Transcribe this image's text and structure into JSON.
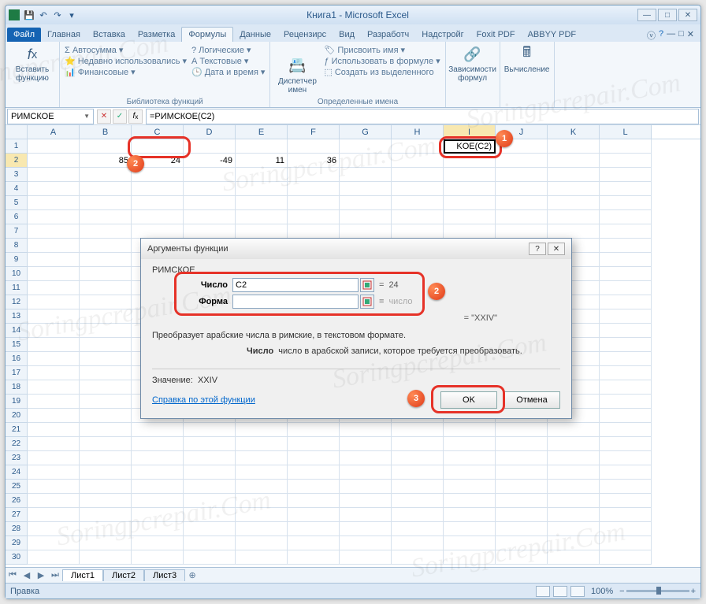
{
  "window": {
    "title": "Книга1 - Microsoft Excel"
  },
  "ribbon_tabs": {
    "file": "Файл",
    "items": [
      "Главная",
      "Вставка",
      "Разметка",
      "Формулы",
      "Данные",
      "Рецензирc",
      "Вид",
      "Разработч",
      "Надстройг",
      "Foxit PDF",
      "ABBYY PDF"
    ],
    "active_index": 3
  },
  "ribbon": {
    "insert_fn": "Вставить функцию",
    "lib": {
      "autosum": "Автосумма",
      "recent": "Недавно использовались",
      "financial": "Финансовые",
      "label": "Библиотека функций",
      "logical": "Логические",
      "text": "Текстовые",
      "datetime": "Дата и время"
    },
    "names": {
      "manager": "Диспетчер имен",
      "assign": "Присвоить имя",
      "use": "Использовать в формуле",
      "create": "Создать из выделенного",
      "label": "Определенные имена"
    },
    "deps": "Зависимости формул",
    "calc": "Вычисление"
  },
  "namebox": "РИМСКОЕ",
  "formula": "=РИМСКОЕ(C2)",
  "columns": [
    "A",
    "B",
    "C",
    "D",
    "E",
    "F",
    "G",
    "H",
    "I",
    "J",
    "K",
    "L"
  ],
  "cells": {
    "B2": "85",
    "C2": "24",
    "D2": "-49",
    "E2": "11",
    "F2": "36",
    "I2": "KOE(C2)"
  },
  "sheets": {
    "active": "Лист1",
    "others": [
      "Лист2",
      "Лист3"
    ]
  },
  "status": {
    "mode": "Правка",
    "zoom": "100%"
  },
  "dialog": {
    "title": "Аргументы функции",
    "fn": "РИМСКОЕ",
    "arg1_label": "Число",
    "arg1_value": "C2",
    "arg1_result": "24",
    "arg2_label": "Форма",
    "arg2_value": "",
    "arg2_result": "число",
    "eq": "=",
    "result_preview": "\"XXIV\"",
    "description": "Преобразует арабские числа в римские, в текстовом формате.",
    "arg_desc_label": "Число",
    "arg_desc_text": "число в арабской записи, которое требуется преобразовать.",
    "value_label": "Значение:",
    "value": "XXIV",
    "help": "Справка по этой функции",
    "ok": "OK",
    "cancel": "Отмена"
  },
  "badges": {
    "b1": "1",
    "b2": "2",
    "b2b": "2",
    "b3": "3"
  },
  "watermark": "Soringpcrepair.Com"
}
